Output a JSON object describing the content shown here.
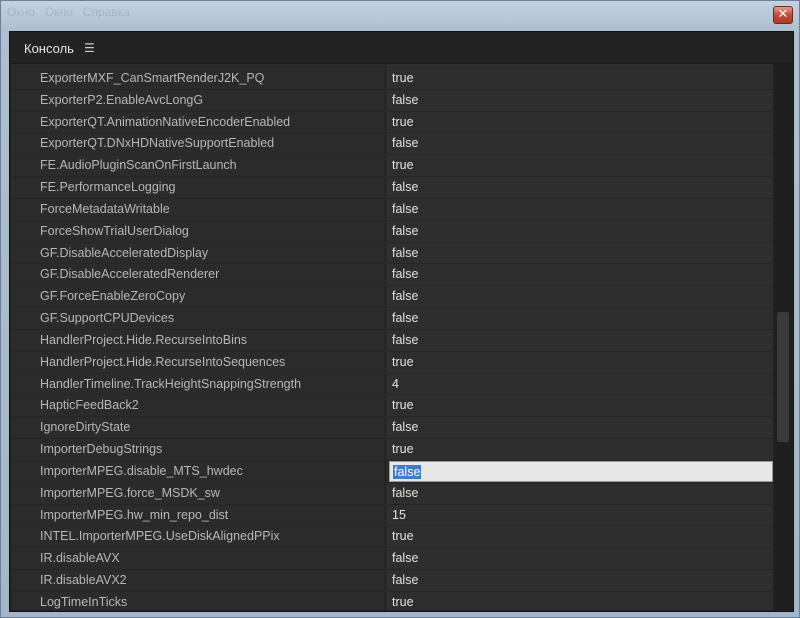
{
  "window": {
    "ghost_menu": [
      "Окно",
      "Окно",
      "Справка"
    ],
    "close_glyph": "✕"
  },
  "panel": {
    "title": "Консоль",
    "menu_glyph": "☰"
  },
  "rows": [
    {
      "key": "ExporterMXF_CanSmartRenderJ2K_PQ",
      "value": "true"
    },
    {
      "key": "ExporterP2.EnableAvcLongG",
      "value": "false"
    },
    {
      "key": "ExporterQT.AnimationNativeEncoderEnabled",
      "value": "true"
    },
    {
      "key": "ExporterQT.DNxHDNativeSupportEnabled",
      "value": "false"
    },
    {
      "key": "FE.AudioPluginScanOnFirstLaunch",
      "value": "true"
    },
    {
      "key": "FE.PerformanceLogging",
      "value": "false"
    },
    {
      "key": "ForceMetadataWritable",
      "value": "false"
    },
    {
      "key": "ForceShowTrialUserDialog",
      "value": "false"
    },
    {
      "key": "GF.DisableAcceleratedDisplay",
      "value": "false"
    },
    {
      "key": "GF.DisableAcceleratedRenderer",
      "value": "false"
    },
    {
      "key": "GF.ForceEnableZeroCopy",
      "value": "false"
    },
    {
      "key": "GF.SupportCPUDevices",
      "value": "false"
    },
    {
      "key": "HandlerProject.Hide.RecurseIntoBins",
      "value": "false"
    },
    {
      "key": "HandlerProject.Hide.RecurseIntoSequences",
      "value": "true"
    },
    {
      "key": "HandlerTimeline.TrackHeightSnappingStrength",
      "value": "4"
    },
    {
      "key": "HapticFeedBack2",
      "value": "true"
    },
    {
      "key": "IgnoreDirtyState",
      "value": "false"
    },
    {
      "key": "ImporterDebugStrings",
      "value": "true"
    },
    {
      "key": "ImporterMPEG.disable_MTS_hwdec",
      "value": "false",
      "editing": true
    },
    {
      "key": "ImporterMPEG.force_MSDK_sw",
      "value": "false"
    },
    {
      "key": "ImporterMPEG.hw_min_repo_dist",
      "value": "15"
    },
    {
      "key": "INTEL.ImporterMPEG.UseDiskAlignedPPix",
      "value": "true"
    },
    {
      "key": "IR.disableAVX",
      "value": "false"
    },
    {
      "key": "IR.disableAVX2",
      "value": "false"
    },
    {
      "key": "LogTimeInTicks",
      "value": "true"
    }
  ]
}
